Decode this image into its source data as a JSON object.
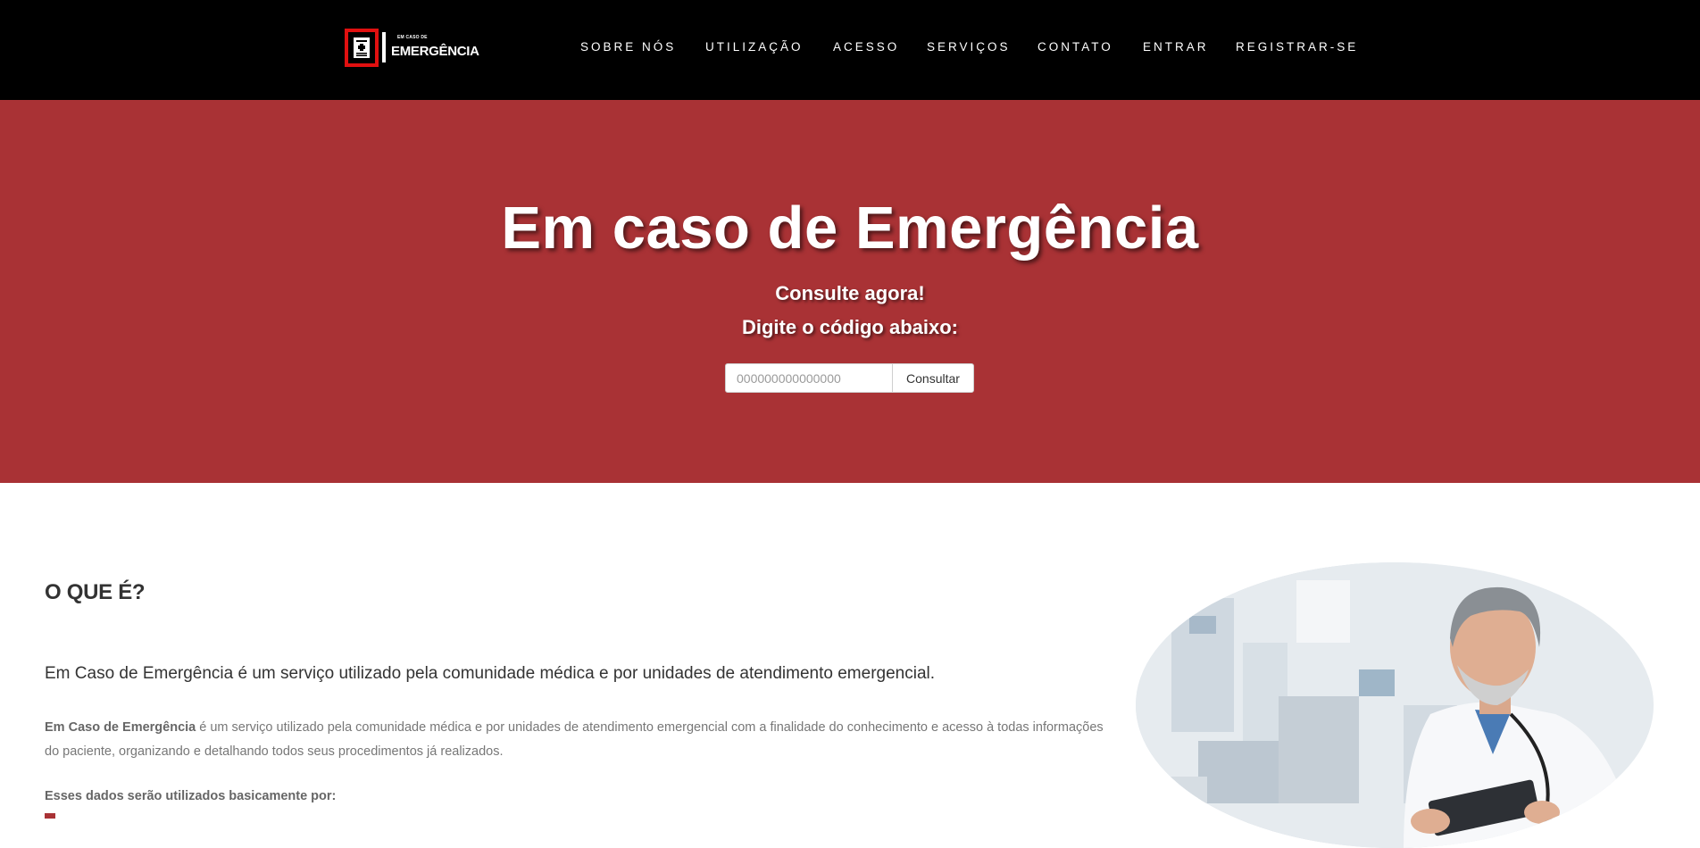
{
  "brand": {
    "logo_small": "EM CASO DE",
    "logo_big": "EMERGÊNCIA"
  },
  "nav": {
    "items": [
      {
        "label": "SOBRE NÓS"
      },
      {
        "label": "UTILIZAÇÃO"
      },
      {
        "label": "ACESSO"
      },
      {
        "label": "SERVIÇOS"
      },
      {
        "label": "CONTATO"
      },
      {
        "label": "ENTRAR"
      },
      {
        "label": "REGISTRAR-SE"
      }
    ]
  },
  "hero": {
    "title": "Em caso de Emergência",
    "subtitle1": "Consulte agora!",
    "subtitle2": "Digite o código abaixo:",
    "search_placeholder": "000000000000000",
    "search_value": "",
    "button_label": "Consultar"
  },
  "about": {
    "title": "O QUE É?",
    "lead": "Em Caso de Emergência é um serviço utilizado pela comunidade médica e por unidades de atendimento emergencial.",
    "body_bold": "Em Caso de Emergência",
    "body_rest": " é um serviço utilizado pela comunidade médica e por unidades de atendimento emergencial com a finalidade do conhecimento e acesso à todas informações do paciente, organizando e detalhando todos seus procedimentos já realizados.",
    "uses_title": "Esses dados serão utilizados basicamente por:"
  },
  "colors": {
    "nav_bg": "#000000",
    "hero_bg": "#a93235",
    "logo_accent": "#e01010"
  }
}
